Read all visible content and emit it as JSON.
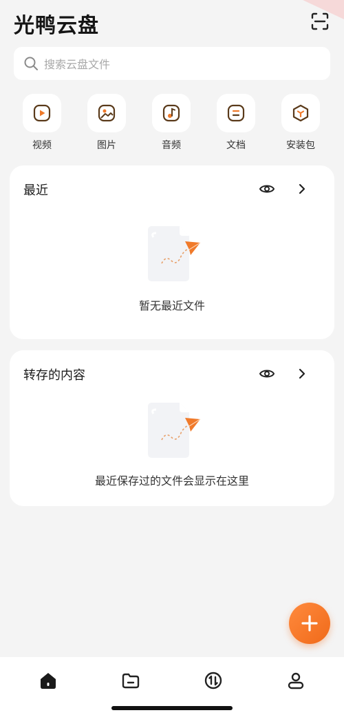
{
  "app": {
    "title": "光鸭云盘"
  },
  "search": {
    "placeholder": "搜索云盘文件"
  },
  "categories": [
    {
      "label": "视频",
      "icon": "video-icon"
    },
    {
      "label": "图片",
      "icon": "image-icon"
    },
    {
      "label": "音频",
      "icon": "music-icon"
    },
    {
      "label": "文档",
      "icon": "document-icon"
    },
    {
      "label": "安装包",
      "icon": "package-icon"
    }
  ],
  "recent": {
    "title": "最近",
    "empty_text": "暂无最近文件"
  },
  "saved": {
    "title": "转存的内容",
    "empty_text": "最近保存过的文件会显示在这里"
  },
  "tabs": [
    {
      "icon": "home-icon"
    },
    {
      "icon": "folder-icon"
    },
    {
      "icon": "transfer-icon"
    },
    {
      "icon": "profile-icon"
    }
  ],
  "colors": {
    "accent": "#f07a2a",
    "icon_stroke": "#5a3a1a",
    "background": "#f4f4f4"
  }
}
